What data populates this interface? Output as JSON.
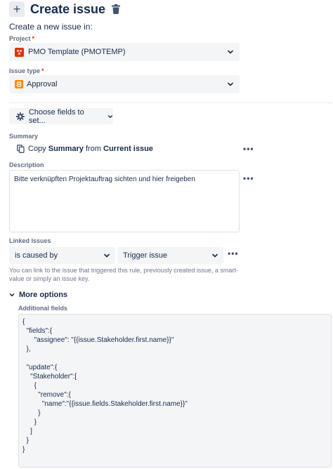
{
  "header": {
    "add_icon_glyph": "+",
    "title": "Create issue",
    "delete_icon": "trash-icon"
  },
  "subtitle": "Create a new issue in:",
  "project": {
    "label": "Project",
    "required_mark": "*",
    "value": "PMO Template (PMOTEMP)",
    "icon": "project-avatar-icon",
    "icon_color": "#de350b"
  },
  "issue_type": {
    "label": "Issue type",
    "required_mark": "*",
    "value": "Approval",
    "icon": "approval-type-icon",
    "icon_color": "#ff8b00"
  },
  "choose_fields": {
    "label": "Choose fields to set...",
    "icon": "gear-icon"
  },
  "summary": {
    "label": "Summary",
    "copy_prefix": "Copy",
    "copy_field": "Summary",
    "copy_from": "from",
    "copy_source": "Current issue",
    "more_glyph": "•••"
  },
  "description": {
    "label": "Description",
    "value": "Bitte verknüpften Projektauftrag sichten und hier freigeben",
    "more_glyph": "•••"
  },
  "linked_issues": {
    "label": "Linked Issues",
    "link_type": "is caused by",
    "target": "Trigger issue",
    "more_glyph": "•••",
    "help": "You can link to the issue that triggered this rule, previously created issue, a smart-value or simply an issue key."
  },
  "more_options": {
    "label": "More options",
    "additional_fields_label": "Additional fields",
    "code_lines": [
      "{",
      "  \"fields\":{",
      "      \"assignee\": \"{{issue.Stakeholder.first.name}}\"",
      "  },",
      "",
      "  \"update\":{",
      "    \"Stakeholder\":[",
      "      {",
      "        \"remove\":{",
      "          \"name\":\"{{issue.fields.Stakeholder.first.name}}\"",
      "        }",
      "      }",
      "    ]",
      "  }",
      "}"
    ]
  },
  "colors": {
    "accent_text": "#172b4d",
    "field_bg": "#f4f5f7",
    "required": "#de350b"
  }
}
